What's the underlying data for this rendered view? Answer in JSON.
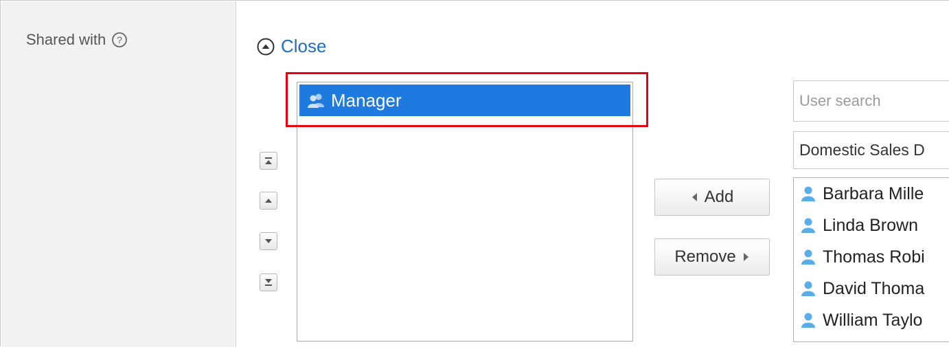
{
  "field": {
    "label": "Shared with"
  },
  "toggle": {
    "label": "Close"
  },
  "selected": {
    "items": [
      {
        "label": "Manager",
        "icon": "role-icon"
      }
    ]
  },
  "order_buttons": [
    "move-top-icon",
    "move-up-icon",
    "move-down-icon",
    "move-bottom-icon"
  ],
  "actions": {
    "add_label": "Add",
    "remove_label": "Remove"
  },
  "search": {
    "placeholder": "User search"
  },
  "department": {
    "value": "Domestic Sales D"
  },
  "users": [
    {
      "name": "Barbara Mille"
    },
    {
      "name": "Linda Brown"
    },
    {
      "name": "Thomas Robi"
    },
    {
      "name": "David Thoma"
    },
    {
      "name": "William Taylo"
    }
  ],
  "colors": {
    "link": "#1f6fc0",
    "selection": "#1f7ae0",
    "highlight": "#e60012",
    "user_icon": "#5aaee8"
  }
}
